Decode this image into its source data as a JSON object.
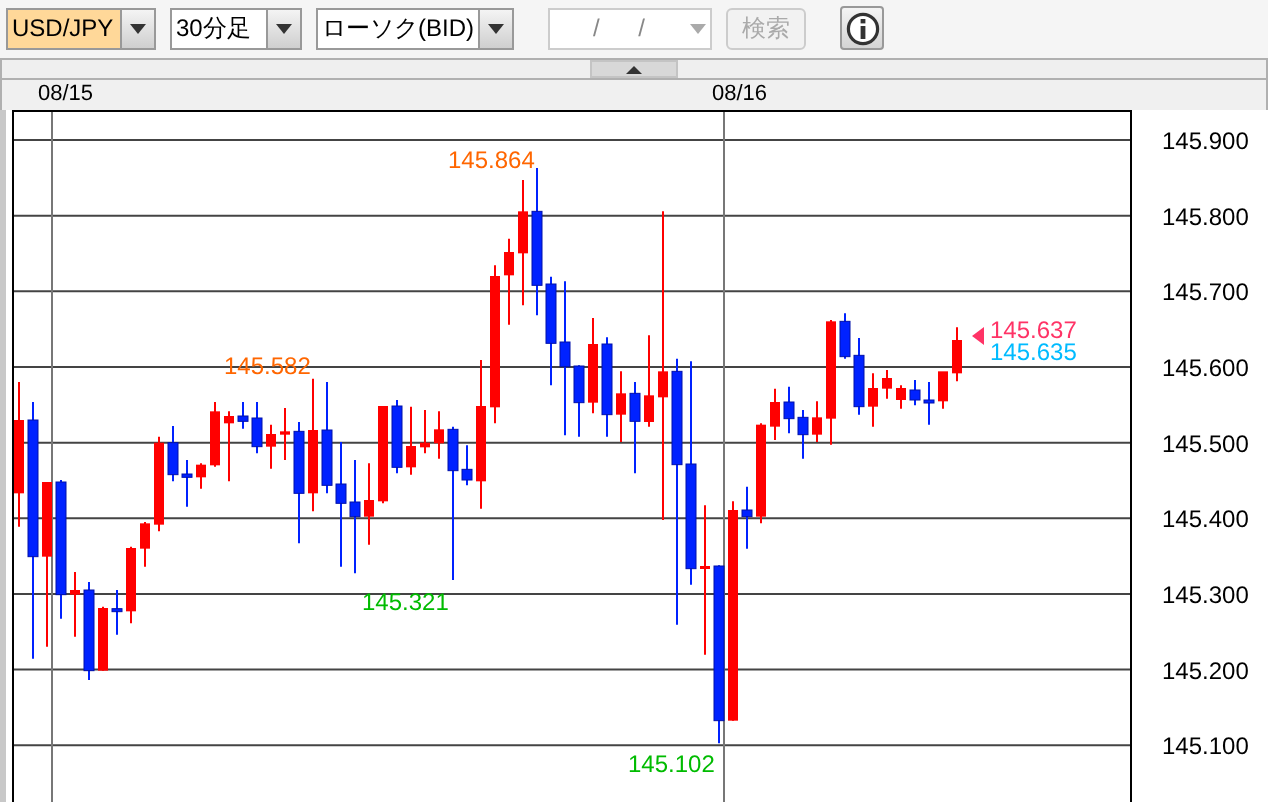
{
  "toolbar": {
    "pair": {
      "value": "USD/JPY"
    },
    "timeframe": {
      "value": "30分足"
    },
    "chart_type": {
      "value": "ローソク(BID)"
    },
    "date": {
      "placeholder": "/ /",
      "disabled": true
    },
    "search_button": {
      "label": "検索",
      "disabled": true
    }
  },
  "date_labels": [
    "08/15",
    "08/16"
  ],
  "price_axis": [
    "145.900",
    "145.800",
    "145.700",
    "145.600",
    "145.500",
    "145.400",
    "145.300",
    "145.200",
    "145.100"
  ],
  "price_labels": [
    {
      "text": "145.864",
      "color": "#ff6600"
    },
    {
      "text": "145.582",
      "color": "#ff6600"
    },
    {
      "text": "145.321",
      "color": "#00bb00"
    },
    {
      "text": "145.102",
      "color": "#00bb00"
    }
  ],
  "current_prices": [
    {
      "text": "145.637",
      "color": "#ff3366"
    },
    {
      "text": "145.635",
      "color": "#00bbff"
    }
  ]
}
